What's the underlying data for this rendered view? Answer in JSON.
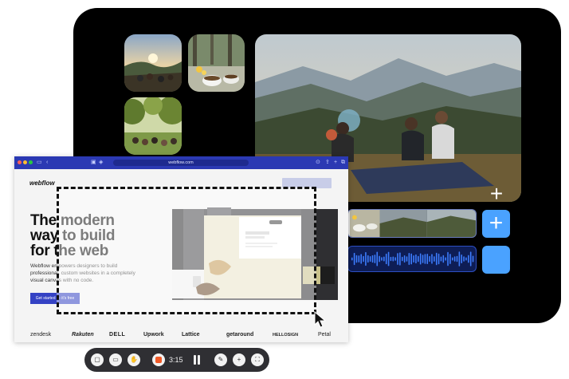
{
  "editor": {
    "media_thumbnails": [
      "sunset-picnic-thumb",
      "coffee-mugs-thumb",
      "crowd-in-trees-thumb"
    ],
    "preview_icon": "mountain-picnic-preview",
    "add_icon": "plus-icon",
    "timeline": {
      "video_track_icon": "video-clip-track",
      "audio_track_icon": "audio-waveform-track",
      "accent_color": "#4aa2ff"
    }
  },
  "browser": {
    "url": "webflow.com",
    "page": {
      "logo": "webflow",
      "headline_lines": [
        "The modern",
        "way to build",
        "for the web"
      ],
      "subtext": "Webflow empowers designers to build professional, custom websites in a completely visual canvas with no code.",
      "cta_label": "Get started — it's free",
      "brand_logos": [
        "zendesk",
        "Rakuten",
        "DELL",
        "Upwork",
        "Lattice",
        "getaround",
        "HELLOSIGN",
        "Petal"
      ]
    }
  },
  "recorder": {
    "time": "3:15",
    "buttons": [
      "screen-icon",
      "camera-icon",
      "hand-icon",
      "record-icon",
      "pause-icon",
      "draw-icon",
      "add-icon",
      "fullscreen-icon"
    ]
  }
}
